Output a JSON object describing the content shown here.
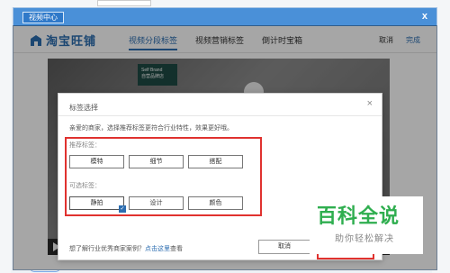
{
  "window": {
    "title": "视频中心",
    "close_glyph": "x"
  },
  "nav": {
    "logo_text": "淘宝旺铺",
    "tabs": [
      {
        "label": "视频分段标签",
        "active": true
      },
      {
        "label": "视频营销标签",
        "active": false
      },
      {
        "label": "倒计时宝箱",
        "active": false
      }
    ],
    "cancel_label": "取消",
    "done_label": "完成"
  },
  "video": {
    "brand_line1": "Self Brand",
    "brand_line2": "自营品牌店"
  },
  "dialog": {
    "title": "标签选择",
    "close_glyph": "×",
    "description": "亲爱的商家，选择推荐标签更符合行业特性，效果更好哦。",
    "recommended_label": "推荐标签：",
    "recommended_tags": [
      "模特",
      "细节",
      "搭配"
    ],
    "optional_label": "可选标签：",
    "optional_tags": [
      {
        "label": "静拍",
        "checked": true
      },
      {
        "label": "设计",
        "checked": false
      },
      {
        "label": "颜色",
        "checked": false
      }
    ],
    "footer_text": "想了解行业优秀商家案例？",
    "footer_link": "点击这里",
    "footer_suffix": "查看",
    "cancel_label": "取消"
  },
  "watermark": {
    "title": "百科全说",
    "subtitle": "助你轻松解决"
  },
  "colors": {
    "accent": "#2c6db0",
    "titlebar": "#4a90d8",
    "highlight_red": "#e0322f",
    "watermark_green": "#2fae4f"
  }
}
